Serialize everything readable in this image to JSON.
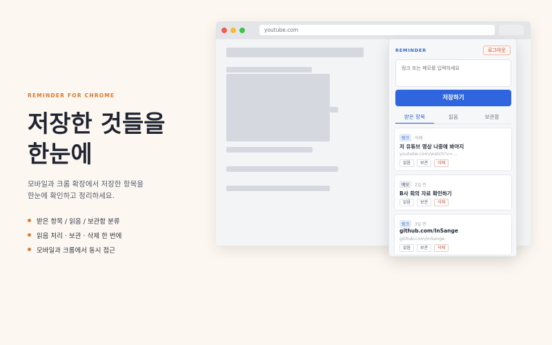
{
  "hero": {
    "eyebrow": "REMINDER FOR CHROME",
    "headline_line1": "저장한 것들을",
    "headline_line2": "한눈에",
    "desc_line1": "모바일과 크롬 확장에서 저장한 항목을",
    "desc_line2": "한눈에 확인하고 정리하세요.",
    "bullets": [
      "받은 항목 / 읽음 / 보관함 분류",
      "읽음 처리 · 보관 · 삭제 한 번에",
      "모바일과 크롬에서 동시 접근"
    ],
    "accent_color": "#e07a2e"
  },
  "browser": {
    "url": "youtube.com"
  },
  "popup": {
    "brand": "REMINDER",
    "logout_label": "로그아웃",
    "memo_placeholder": "링크 또는 메모를 입력하세요",
    "save_label": "저장하기",
    "primary_color": "#2f66e0",
    "tabs": [
      {
        "label": "받은 항목",
        "active": true
      },
      {
        "label": "읽음",
        "active": false
      },
      {
        "label": "보관함",
        "active": false
      }
    ],
    "items": [
      {
        "type": "링크",
        "time": "어제",
        "title": "저 유튜브 영상 나중에 봐야지",
        "subtitle": "youtube.com/watch?v=...",
        "actions": [
          "읽음",
          "보관",
          "삭제"
        ]
      },
      {
        "type": "메모",
        "time": "2일 전",
        "title": "B사 회의 자료 확인하기",
        "subtitle": "",
        "actions": [
          "읽음",
          "보관",
          "삭제"
        ]
      },
      {
        "type": "링크",
        "time": "3일 전",
        "title": "github.com/InSange",
        "subtitle": "github.com/InSange",
        "actions": [
          "읽음",
          "보관",
          "삭제"
        ]
      }
    ]
  }
}
